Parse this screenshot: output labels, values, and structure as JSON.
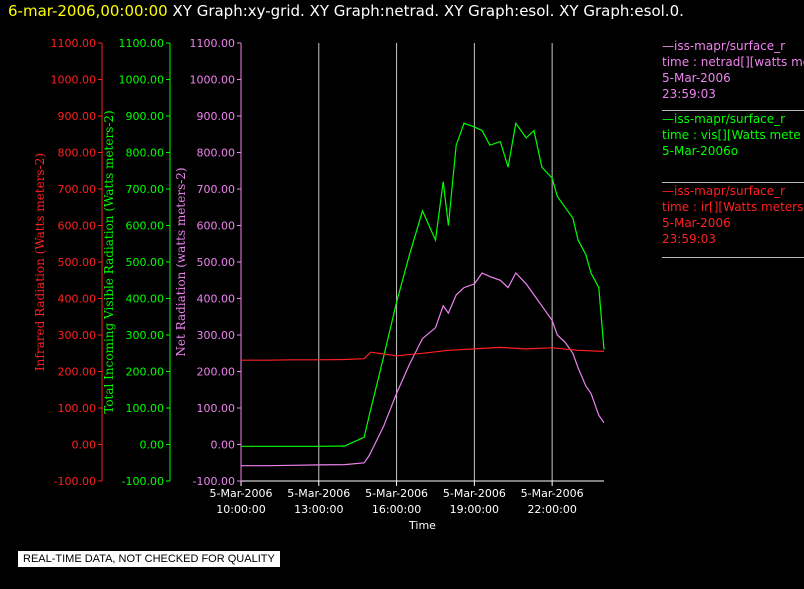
{
  "header": {
    "time": "6-mar-2006,00:00:00",
    "graphs": [
      "XY Graph:xy-grid.",
      "XY Graph:netrad.",
      "XY Graph:esol.",
      "XY Graph:esol.0."
    ]
  },
  "legend": {
    "net": {
      "source": "—iss-mapr/surface_r",
      "var": "time : netrad[][watts me",
      "date": "5-Mar-2006",
      "time": "23:59:03"
    },
    "vis": {
      "source": "—iss-mapr/surface_r",
      "var": "time : vis[][Watts mete",
      "date": "5-Mar-2006o"
    },
    "ir": {
      "source": "—iss-mapr/surface_r",
      "var": "time : ir[][Watts meters",
      "date": "5-Mar-2006",
      "time": "23:59:03"
    }
  },
  "note": "REAL-TIME DATA, NOT CHECKED FOR QUALITY",
  "colors": {
    "net": "#ee82ee",
    "vis": "#00ff00",
    "ir": "#ff2020",
    "grid": "#c8c8c8",
    "axis": "#ffffff"
  },
  "chart_data": {
    "type": "line",
    "xlabel": "Time",
    "x_ticks": [
      {
        "x": 10,
        "date": "5-Mar-2006",
        "time": "10:00:00"
      },
      {
        "x": 13,
        "date": "5-Mar-2006",
        "time": "13:00:00"
      },
      {
        "x": 16,
        "date": "5-Mar-2006",
        "time": "16:00:00"
      },
      {
        "x": 19,
        "date": "5-Mar-2006",
        "time": "19:00:00"
      },
      {
        "x": 22,
        "date": "5-Mar-2006",
        "time": "22:00:00"
      }
    ],
    "x_range": [
      10,
      24
    ],
    "y_ticks": [
      -100,
      0,
      100,
      200,
      300,
      400,
      500,
      600,
      700,
      800,
      900,
      1000,
      1100
    ],
    "y_tick_labels": [
      "-100.00",
      "0.00",
      "100.00",
      "200.00",
      "300.00",
      "400.00",
      "500.00",
      "600.00",
      "700.00",
      "800.00",
      "900.00",
      "1000.00",
      "1100.00"
    ],
    "axes": [
      {
        "key": "ir",
        "label": "Infrared Radiation (Watts meters-2)",
        "color": "#ff2020",
        "ylim": [
          -100,
          1100
        ]
      },
      {
        "key": "vis",
        "label": "Total Incoming Visible Radiation (Watts meters-2)",
        "color": "#00ff00",
        "ylim": [
          -100,
          1100
        ]
      },
      {
        "key": "net",
        "label": "Net Radiation (watts meters-2)",
        "color": "#ee82ee",
        "ylim": [
          -100,
          1100
        ]
      }
    ],
    "grid": "vertical",
    "series": [
      {
        "key": "vis",
        "color": "#00ff00",
        "x": [
          10,
          11,
          12,
          13,
          14,
          14.75,
          14.95,
          15.5,
          16,
          16.5,
          17,
          17.5,
          17.8,
          18,
          18.3,
          18.6,
          19,
          19.3,
          19.6,
          20,
          20.3,
          20.6,
          21,
          21.3,
          21.6,
          22,
          22.2,
          22.5,
          22.8,
          23,
          23.3,
          23.5,
          23.8,
          24
        ],
        "y": [
          -5,
          -5,
          -5,
          -5,
          -4,
          20,
          80,
          240,
          390,
          520,
          640,
          560,
          720,
          600,
          820,
          880,
          870,
          860,
          820,
          830,
          760,
          880,
          840,
          860,
          760,
          730,
          680,
          650,
          620,
          560,
          520,
          470,
          430,
          260
        ]
      },
      {
        "key": "net",
        "color": "#ee82ee",
        "x": [
          10,
          11,
          12,
          13,
          14,
          14.75,
          14.95,
          15.5,
          16,
          16.5,
          17,
          17.5,
          17.8,
          18,
          18.3,
          18.6,
          19,
          19.3,
          19.6,
          20,
          20.3,
          20.6,
          21,
          21.3,
          21.6,
          22,
          22.2,
          22.5,
          22.8,
          23,
          23.3,
          23.5,
          23.8,
          24
        ],
        "y": [
          -58,
          -58,
          -57,
          -56,
          -55,
          -50,
          -30,
          50,
          140,
          220,
          290,
          320,
          380,
          360,
          410,
          430,
          440,
          470,
          460,
          450,
          430,
          470,
          440,
          410,
          380,
          340,
          300,
          280,
          250,
          210,
          160,
          140,
          80,
          60
        ]
      },
      {
        "key": "ir",
        "color": "#ff2020",
        "x": [
          10,
          11,
          12,
          13,
          14,
          14.75,
          15,
          15.5,
          16,
          17,
          18,
          19,
          20,
          21,
          22,
          23,
          24
        ],
        "y": [
          231,
          231,
          232,
          232,
          233,
          235,
          253,
          248,
          243,
          250,
          258,
          262,
          266,
          262,
          265,
          258,
          255
        ]
      }
    ]
  }
}
